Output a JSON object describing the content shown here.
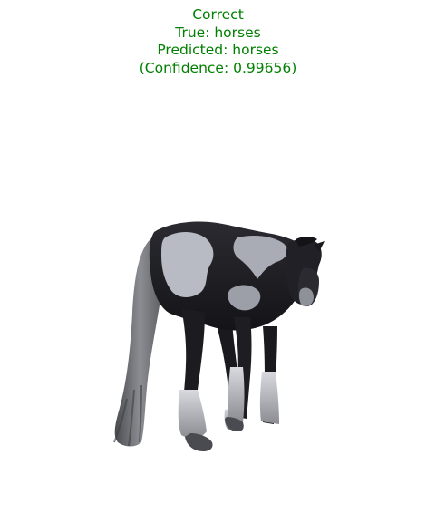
{
  "title": {
    "status": "Correct",
    "true_label": "True: horses",
    "predicted_label": "Predicted: horses",
    "confidence": "(Confidence: 0.99656)"
  },
  "colors": {
    "title_text": "#008000",
    "background": "#ffffff",
    "coat_dark": "#1c1c20",
    "coat_white": "#b9bcc4",
    "tail": "#6e7074"
  },
  "image": {
    "subject": "horse-illustration"
  }
}
